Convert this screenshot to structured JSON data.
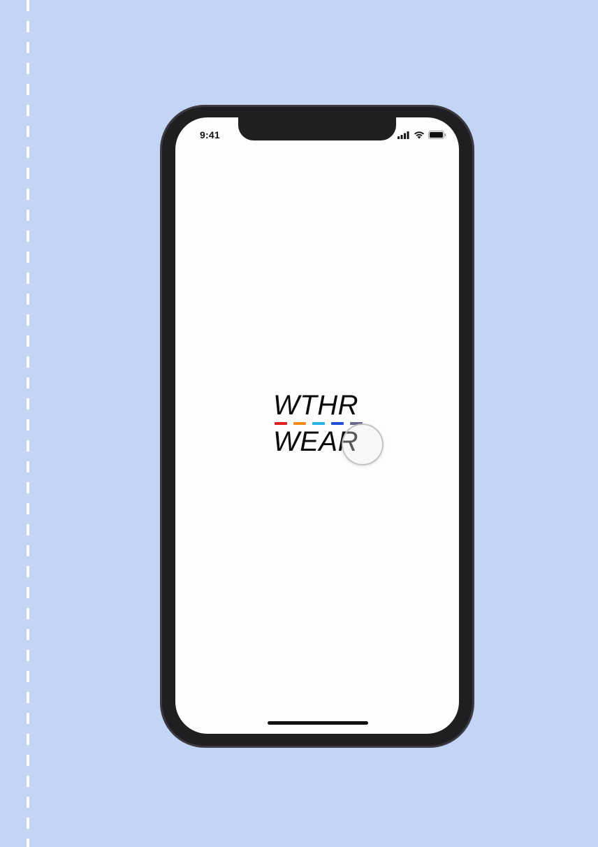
{
  "status_bar": {
    "time": "9:41",
    "icons": [
      "cellular-signal-icon",
      "wifi-icon",
      "battery-icon"
    ]
  },
  "logo": {
    "line1": "WTHR",
    "line2": "WEAR",
    "bar_colors": [
      "#e02020",
      "#f08a1c",
      "#29b1e8",
      "#1f4fd8",
      "#6b6b8a"
    ]
  },
  "colors": {
    "background": "#c3d4f5",
    "screen": "#fdfdfd",
    "device_frame": "#1f1f22"
  }
}
